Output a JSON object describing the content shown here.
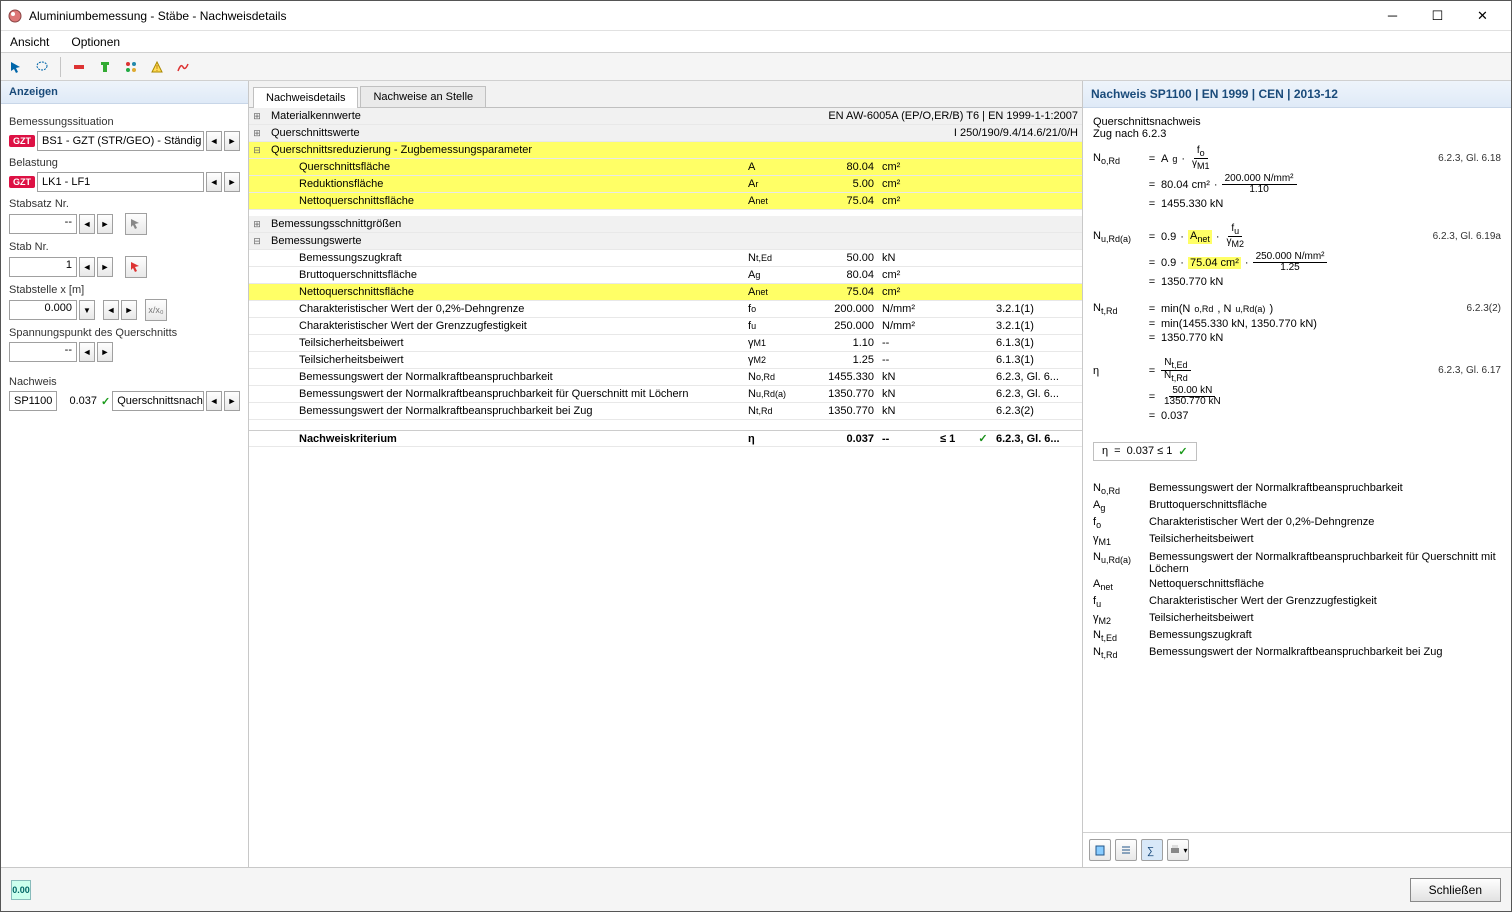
{
  "window_title": "Aluminiumbemessung - Stäbe - Nachweisdetails",
  "menu": {
    "view": "Ansicht",
    "options": "Optionen"
  },
  "left": {
    "header": "Anzeigen",
    "situation_label": "Bemessungssituation",
    "situation_value": "BS1 - GZT (STR/GEO) - Ständig ...",
    "belastung_label": "Belastung",
    "belastung_value": "LK1 - LF1",
    "stabsatz_label": "Stabsatz Nr.",
    "stabsatz_value": "--",
    "stab_label": "Stab Nr.",
    "stab_value": "1",
    "stabstelle_label": "Stabstelle x [m]",
    "stabstelle_value": "0.000",
    "spannung_label": "Spannungspunkt des Querschnitts",
    "spannung_value": "--",
    "nachweis_label": "Nachweis",
    "nachweis_id": "SP1100",
    "nachweis_ratio": "0.037",
    "nachweis_text": "Querschnittsnach...",
    "badge_gzt": "GZT"
  },
  "tabs": {
    "details": "Nachweisdetails",
    "anstelle": "Nachweise an Stelle"
  },
  "grid": {
    "matkenn": {
      "title": "Materialkennwerte",
      "right": "EN AW-6005A (EP/O,ER/B) T6 | EN 1999-1-1:2007"
    },
    "querschnitt": {
      "title": "Querschnittswerte",
      "right": "I 250/190/9.4/14.6/21/0/H"
    },
    "reduz": {
      "title": "Querschnittsreduzierung - Zugbemessungsparameter",
      "r1": {
        "n": "Querschnittsfläche",
        "s": "A",
        "v": "80.04",
        "u": "cm²"
      },
      "r2": {
        "n": "Reduktionsfläche",
        "s": "Ar",
        "v": "5.00",
        "u": "cm²"
      },
      "r3": {
        "n": "Nettoquerschnittsfläche",
        "s": "Anet",
        "v": "75.04",
        "u": "cm²"
      }
    },
    "bemgr": {
      "title": "Bemessungsschnittgrößen"
    },
    "bemw": {
      "title": "Bemessungswerte",
      "r1": {
        "n": "Bemessungszugkraft",
        "s": "Nt,Ed",
        "v": "50.00",
        "u": "kN"
      },
      "r2": {
        "n": "Bruttoquerschnittsfläche",
        "s": "Ag",
        "v": "80.04",
        "u": "cm²"
      },
      "r3": {
        "n": "Nettoquerschnittsfläche",
        "s": "Anet",
        "v": "75.04",
        "u": "cm²"
      },
      "r4": {
        "n": "Charakteristischer Wert der 0,2%-Dehngrenze",
        "s": "fo",
        "v": "200.000",
        "u": "N/mm²",
        "ref": "3.2.1(1)"
      },
      "r5": {
        "n": "Charakteristischer Wert der Grenzzugfestigkeit",
        "s": "fu",
        "v": "250.000",
        "u": "N/mm²",
        "ref": "3.2.1(1)"
      },
      "r6": {
        "n": "Teilsicherheitsbeiwert",
        "s": "γM1",
        "v": "1.10",
        "u": "--",
        "ref": "6.1.3(1)"
      },
      "r7": {
        "n": "Teilsicherheitsbeiwert",
        "s": "γM2",
        "v": "1.25",
        "u": "--",
        "ref": "6.1.3(1)"
      },
      "r8": {
        "n": "Bemessungswert der Normalkraftbeanspruchbarkeit",
        "s": "No,Rd",
        "v": "1455.330",
        "u": "kN",
        "ref": "6.2.3, Gl. 6..."
      },
      "r9": {
        "n": "Bemessungswert der Normalkraftbeanspruchbarkeit für Querschnitt mit Löchern",
        "s": "Nu,Rd(a)",
        "v": "1350.770",
        "u": "kN",
        "ref": "6.2.3, Gl. 6..."
      },
      "r10": {
        "n": "Bemessungswert der Normalkraftbeanspruchbarkeit bei Zug",
        "s": "Nt,Rd",
        "v": "1350.770",
        "u": "kN",
        "ref": "6.2.3(2)"
      }
    },
    "krit": {
      "n": "Nachweiskriterium",
      "s": "η",
      "v": "0.037",
      "u": "--",
      "cmp": "≤ 1",
      "ref": "6.2.3, Gl. 6..."
    }
  },
  "right": {
    "header": "Nachweis SP1100 | EN 1999 | CEN | 2013-12",
    "subtitle1": "Querschnittsnachweis",
    "subtitle2": "Zug nach 6.2.3",
    "eq": {
      "nord": {
        "sym": "No,Rd",
        "ref": "6.2.3, Gl. 6.18",
        "line1_rhs": "Ag · fo / γM1",
        "line2_l": "80.04 cm²",
        "line2_num": "200.000 N/mm²",
        "line2_den": "1.10",
        "line3": "1455.330 kN"
      },
      "nurd": {
        "sym": "Nu,Rd(a)",
        "ref": "6.2.3, Gl. 6.19a",
        "line1_09": "0.9",
        "line1_anet": "Anet",
        "line1_fu": "fu",
        "line1_gm2": "γM2",
        "line2_09": "0.9",
        "line2_anet": "75.04 cm²",
        "line2_num": "250.000 N/mm²",
        "line2_den": "1.25",
        "line3": "1350.770 kN"
      },
      "ntrd": {
        "sym": "Nt,Rd",
        "ref": "6.2.3(2)",
        "line1": "min(No,Rd, Nu,Rd(a))",
        "line2": "min(1455.330 kN, 1350.770 kN)",
        "line3": "1350.770 kN"
      },
      "eta": {
        "sym": "η",
        "ref": "6.2.3, Gl. 6.17",
        "frac_num": "Nt,Ed",
        "frac_den": "Nt,Rd",
        "num2": "50.00 kN",
        "den2": "1350.770 kN",
        "val": "0.037",
        "final": "0.037 ≤ 1"
      }
    },
    "legend": {
      "l1": {
        "s": "No,Rd",
        "d": "Bemessungswert der Normalkraftbeanspruchbarkeit"
      },
      "l2": {
        "s": "Ag",
        "d": "Bruttoquerschnittsfläche"
      },
      "l3": {
        "s": "fo",
        "d": "Charakteristischer Wert der 0,2%-Dehngrenze"
      },
      "l4": {
        "s": "γM1",
        "d": "Teilsicherheitsbeiwert"
      },
      "l5": {
        "s": "Nu,Rd(a)",
        "d": "Bemessungswert der Normalkraftbeanspruchbarkeit für Querschnitt mit Löchern"
      },
      "l6": {
        "s": "Anet",
        "d": "Nettoquerschnittsfläche"
      },
      "l7": {
        "s": "fu",
        "d": "Charakteristischer Wert der Grenzzugfestigkeit"
      },
      "l8": {
        "s": "γM2",
        "d": "Teilsicherheitsbeiwert"
      },
      "l9": {
        "s": "Nt,Ed",
        "d": "Bemessungszugkraft"
      },
      "l10": {
        "s": "Nt,Rd",
        "d": "Bemessungswert der Normalkraftbeanspruchbarkeit bei Zug"
      }
    }
  },
  "footer": {
    "close": "Schließen",
    "status": "0.00"
  }
}
